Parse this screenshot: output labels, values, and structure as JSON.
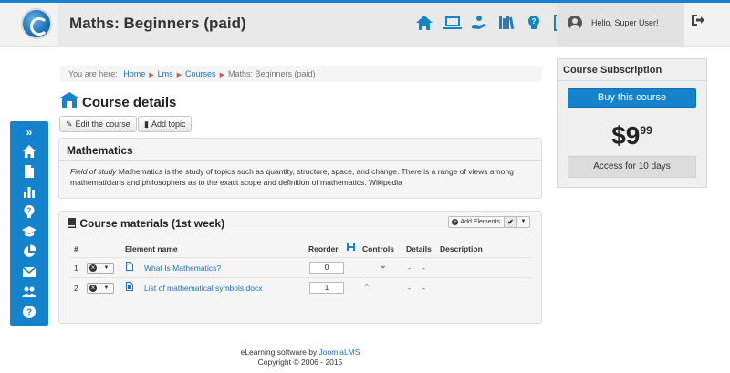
{
  "header": {
    "course_title": "Maths: Beginners (paid)",
    "nav_icons": [
      "home-icon",
      "laptop-icon",
      "hand-coins-icon",
      "books-icon",
      "lightbulb-icon",
      "form-icon",
      "users-icon"
    ],
    "greeting": "Hello, Super User!",
    "accent_color": "#1583cc"
  },
  "sidebar": {
    "toggle": "»",
    "items": [
      "home-icon",
      "document-icon",
      "chart-icon",
      "question-icon",
      "graduation-cap-icon",
      "pie-chart-icon",
      "inbox-icon",
      "users-icon",
      "help-icon"
    ]
  },
  "breadcrumb": {
    "prefix": "You are here:",
    "items": [
      "Home",
      "Lms",
      "Courses"
    ],
    "current": "Maths: Beginners (paid)"
  },
  "page": {
    "heading": "Course details",
    "edit_button": "Edit the course",
    "add_topic_button": "Add topic"
  },
  "topic": {
    "title": "Mathematics",
    "desc_italic": "Field of study",
    "desc_text": " Mathematics is the study of topics such as quantity, structure, space, and change. There is a range of views among mathematicians and philosophers as to the exact scope and definition of mathematics. Wikipedia"
  },
  "materials": {
    "title": "Course materials (1st week)",
    "add_elements": "Add Elements",
    "columns": {
      "num": "#",
      "name": "Element name",
      "reorder": "Reorder",
      "controls": "Controls",
      "details": "Details",
      "description": "Description"
    },
    "rows": [
      {
        "num": "1",
        "name": "What Is Mathematics?",
        "order": "0",
        "control": "⌄",
        "details": "-",
        "description": "-"
      },
      {
        "num": "2",
        "name": "List of mathematical symbols.docx",
        "order": "1",
        "control": "⌃",
        "details": "-",
        "description": "-"
      }
    ]
  },
  "subscription": {
    "title": "Course Subscription",
    "buy_label": "Buy this course",
    "price_main": "$9",
    "price_cents": "99",
    "access": "Access for 10 days"
  },
  "footer": {
    "line1_prefix": "eLearning software by ",
    "line1_link": "JoomlaLMS",
    "line2": "Copyright © 2006 - 2015"
  }
}
